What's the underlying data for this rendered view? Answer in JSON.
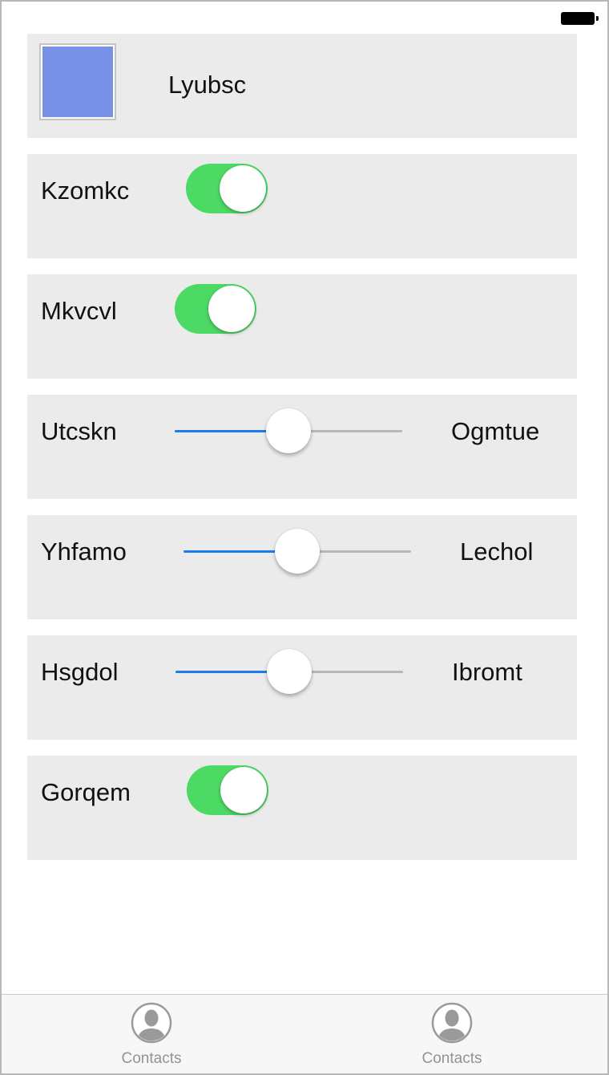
{
  "status_bar": {
    "battery_icon": "battery-full-icon"
  },
  "color_row": {
    "swatch_color": "#7891e6",
    "label": "Lyubsc"
  },
  "toggles": [
    {
      "label": "Kzomkc",
      "on": true
    },
    {
      "label": "Mkvcvl",
      "on": true
    },
    {
      "label": "Gorqem",
      "on": true
    }
  ],
  "sliders": [
    {
      "label": "Utcskn",
      "value_label": "Ogmtue",
      "value": 0.5
    },
    {
      "label": "Yhfamo",
      "value_label": "Lechol",
      "value": 0.5
    },
    {
      "label": "Hsgdol",
      "value_label": "Ibromt",
      "value": 0.5
    }
  ],
  "tab_bar": {
    "tabs": [
      {
        "label": "Contacts",
        "icon": "contact-icon"
      },
      {
        "label": "Contacts",
        "icon": "contact-icon"
      }
    ]
  },
  "colors": {
    "toggle_on": "#4cd964",
    "slider_fill": "#1b7cf0",
    "slider_track": "#b7b7b7",
    "row_background": "#ebebeb"
  }
}
